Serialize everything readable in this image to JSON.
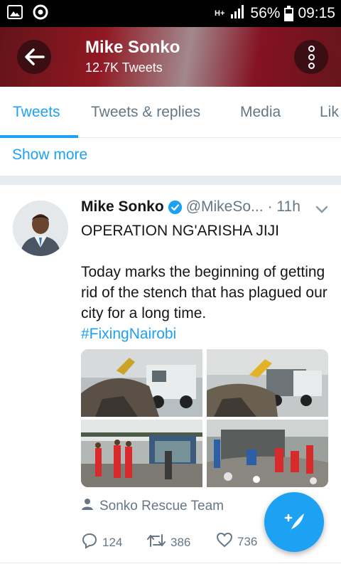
{
  "status_bar": {
    "network": "H+",
    "battery": "56%",
    "time": "09:15"
  },
  "header": {
    "title": "Mike Sonko",
    "subtitle": "12.7K Tweets"
  },
  "tabs": [
    {
      "label": "Tweets"
    },
    {
      "label": "Tweets & replies"
    },
    {
      "label": "Media"
    },
    {
      "label": "Lik"
    }
  ],
  "show_more": "Show more",
  "tweet": {
    "name": "Mike Sonko",
    "handle": "@MikeSo...",
    "time": "· 11h",
    "line1": "OPERATION NG'ARISHA JIJI",
    "line2": "Today marks the beginning of getting rid of the stench that has plagued our city for a long time.",
    "hashtag": "#FixingNairobi",
    "attribution": "Sonko Rescue Team",
    "replies": "124",
    "retweets": "386",
    "likes": "736"
  },
  "colors": {
    "accent": "#1da1f2",
    "secondary_text": "#657786",
    "header": "#b01e2a"
  },
  "icons": [
    "image-icon",
    "chrome-icon",
    "signal-icon",
    "battery-icon",
    "back-arrow-icon",
    "more-icon",
    "verified-icon",
    "chevron-down-icon",
    "person-icon",
    "reply-icon",
    "retweet-icon",
    "like-icon",
    "compose-icon"
  ]
}
